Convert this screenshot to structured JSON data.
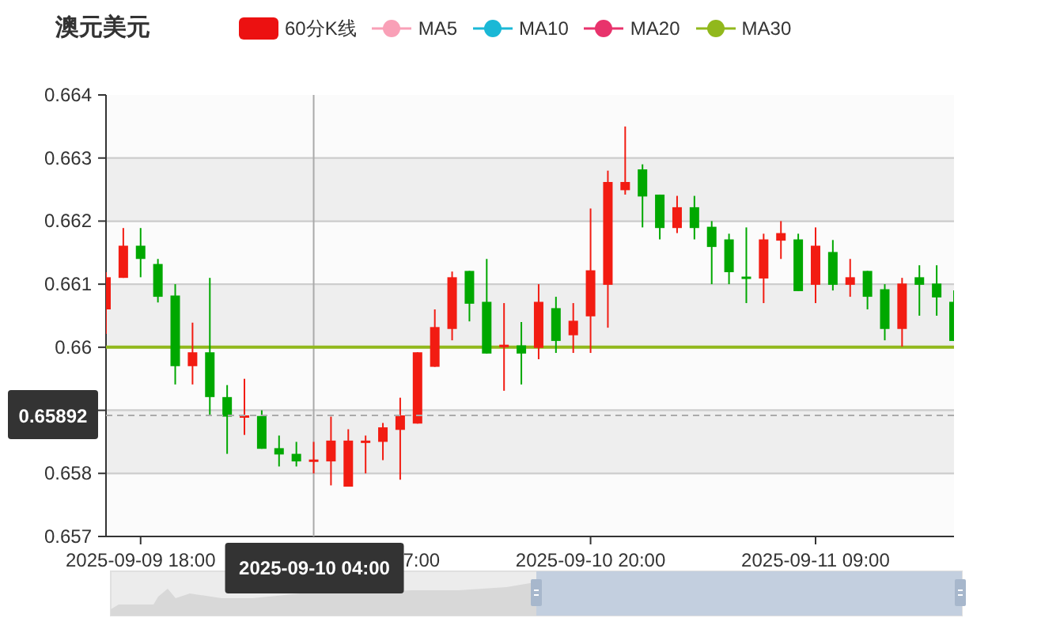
{
  "title": "澳元美元",
  "legend": [
    {
      "label": "60分K线",
      "kind": "candle",
      "color": "#ec1111"
    }
  ],
  "chart": {
    "chart_data": {
      "type": "candlestick",
      "categories": [
        null,
        null,
        "2025-09-09 18:00",
        null,
        null,
        null,
        null,
        null,
        null,
        null,
        null,
        null,
        "2025-09-10 04:00",
        null,
        null,
        null,
        null,
        null,
        null,
        null,
        null,
        null,
        null,
        null,
        null,
        null,
        null,
        null,
        "2025-09-10 20:00",
        null,
        null,
        null,
        null,
        null,
        null,
        null,
        null,
        null,
        null,
        null,
        null,
        "2025-09-11 09:00",
        null,
        null,
        null,
        null,
        null,
        null,
        null,
        null
      ],
      "ohlc": [
        [
          0.6606,
          0.66119,
          0.66021,
          0.66111
        ],
        [
          0.6611,
          0.66189,
          0.6611,
          0.66161
        ],
        [
          0.66161,
          0.66189,
          0.66111,
          0.6614
        ],
        [
          0.66132,
          0.6614,
          0.66071,
          0.6608
        ],
        [
          0.66082,
          0.661,
          0.65941,
          0.6597
        ],
        [
          0.6597,
          0.66039,
          0.65941,
          0.65992
        ],
        [
          0.65992,
          0.6611,
          0.65892,
          0.65921
        ],
        [
          0.65921,
          0.6594,
          0.65831,
          0.6589
        ],
        [
          0.65889,
          0.6595,
          0.65861,
          0.65892
        ],
        [
          0.65891,
          0.659,
          0.65839,
          0.65839
        ],
        [
          0.6584,
          0.6586,
          0.65811,
          0.6583
        ],
        [
          0.65831,
          0.6585,
          0.65811,
          0.65819
        ],
        [
          0.65819,
          0.6585,
          0.658,
          0.65822
        ],
        [
          0.65819,
          0.6589,
          0.65781,
          0.65852
        ],
        [
          0.65779,
          0.6587,
          0.65779,
          0.65852
        ],
        [
          0.6585,
          0.6586,
          0.658,
          0.65852
        ],
        [
          0.6585,
          0.6588,
          0.65821,
          0.65873
        ],
        [
          0.65869,
          0.6592,
          0.6579,
          0.65892
        ],
        [
          0.65879,
          0.65992,
          0.65879,
          0.65992
        ],
        [
          0.65969,
          0.6606,
          0.65969,
          0.66032
        ],
        [
          0.66029,
          0.6612,
          0.66011,
          0.66111
        ],
        [
          0.66121,
          0.66121,
          0.66041,
          0.66069
        ],
        [
          0.66072,
          0.6614,
          0.6599,
          0.6599
        ],
        [
          0.66,
          0.6607,
          0.65931,
          0.66004
        ],
        [
          0.66003,
          0.6604,
          0.65941,
          0.6599
        ],
        [
          0.65999,
          0.661,
          0.65981,
          0.66072
        ],
        [
          0.66062,
          0.6608,
          0.65991,
          0.6601
        ],
        [
          0.66019,
          0.6607,
          0.65991,
          0.66042
        ],
        [
          0.66049,
          0.6622,
          0.65991,
          0.66122
        ],
        [
          0.66099,
          0.6628,
          0.66031,
          0.66262
        ],
        [
          0.66249,
          0.6635,
          0.66242,
          0.66262
        ],
        [
          0.66282,
          0.6629,
          0.6619,
          0.66239
        ],
        [
          0.66242,
          0.66242,
          0.66171,
          0.66189
        ],
        [
          0.66189,
          0.6624,
          0.66181,
          0.66222
        ],
        [
          0.66222,
          0.6624,
          0.66171,
          0.66189
        ],
        [
          0.66191,
          0.662,
          0.661,
          0.66159
        ],
        [
          0.66171,
          0.6618,
          0.661,
          0.66119
        ],
        [
          0.66112,
          0.6619,
          0.6607,
          0.6611
        ],
        [
          0.66109,
          0.6618,
          0.6607,
          0.66171
        ],
        [
          0.66169,
          0.662,
          0.6614,
          0.66181
        ],
        [
          0.66171,
          0.6618,
          0.66089,
          0.66089
        ],
        [
          0.66099,
          0.6619,
          0.6607,
          0.66161
        ],
        [
          0.66151,
          0.6617,
          0.6609,
          0.66099
        ],
        [
          0.66099,
          0.6614,
          0.6608,
          0.66111
        ],
        [
          0.66121,
          0.66121,
          0.6606,
          0.6608
        ],
        [
          0.66092,
          0.661,
          0.66011,
          0.66029
        ],
        [
          0.66029,
          0.6611,
          0.66001,
          0.66101
        ],
        [
          0.66111,
          0.6613,
          0.6605,
          0.66099
        ],
        [
          0.66101,
          0.6613,
          0.6605,
          0.66079
        ],
        [
          0.66072,
          0.6609,
          0.6601,
          0.6601
        ]
      ],
      "series": [
        {
          "name": "MA5",
          "type": "line",
          "color": "#f9a0b7",
          "values": [
            null,
            null,
            null,
            null,
            null,
            null,
            null,
            null,
            null,
            null,
            null,
            null,
            null,
            null,
            null,
            null,
            null,
            null,
            null,
            null,
            null,
            null,
            null,
            null,
            null,
            null,
            null,
            null,
            null,
            null,
            null,
            null,
            null,
            null,
            null,
            null,
            null,
            null,
            null,
            null,
            null,
            null,
            null,
            null,
            null,
            null,
            null,
            null,
            null,
            null
          ]
        },
        {
          "name": "MA10",
          "type": "line",
          "color": "#1ab8d6",
          "values": [
            null,
            null,
            null,
            null,
            null,
            null,
            null,
            null,
            null,
            null,
            null,
            null,
            null,
            null,
            null,
            null,
            null,
            null,
            null,
            null,
            null,
            null,
            null,
            null,
            null,
            null,
            null,
            null,
            null,
            null,
            null,
            null,
            null,
            null,
            null,
            null,
            null,
            null,
            null,
            null,
            null,
            null,
            null,
            null,
            null,
            null,
            null,
            null,
            null,
            null
          ]
        },
        {
          "name": "MA20",
          "type": "line",
          "color": "#e8336c",
          "values": [
            null,
            null,
            null,
            null,
            null,
            null,
            null,
            null,
            null,
            null,
            null,
            null,
            null,
            null,
            null,
            null,
            null,
            null,
            null,
            null,
            null,
            null,
            null,
            null,
            null,
            null,
            null,
            null,
            null,
            null,
            null,
            null,
            null,
            null,
            null,
            null,
            null,
            null,
            null,
            null,
            null,
            null,
            null,
            null,
            null,
            null,
            null,
            null,
            null,
            null
          ]
        },
        {
          "name": "MA30",
          "type": "line",
          "color": "#91b81c",
          "values": [
            0.66,
            0.66,
            0.66,
            0.66,
            0.66,
            0.66,
            0.66,
            0.66,
            0.66,
            0.66,
            0.66,
            0.66,
            0.66,
            0.66,
            0.66,
            0.66,
            0.66,
            0.66,
            0.66,
            0.66,
            0.66,
            0.66,
            0.66,
            0.66,
            0.66,
            0.66,
            0.66,
            0.66,
            0.66,
            0.66,
            0.66,
            0.66,
            0.66,
            0.66,
            0.66,
            0.66,
            0.66,
            0.66,
            0.66,
            0.66,
            0.66,
            0.66,
            0.66,
            0.66,
            0.66,
            0.66,
            0.66,
            0.66,
            0.66,
            0.66
          ]
        }
      ],
      "grid": true,
      "ylim": [
        0.657,
        0.664
      ],
      "yticks": [
        0.657,
        0.658,
        0.66,
        0.661,
        0.662,
        0.663,
        0.664
      ],
      "bands": [
        {
          "axis": "y",
          "from": 0.662,
          "to": 0.663
        },
        {
          "axis": "y",
          "from": 0.66,
          "to": 0.661
        },
        {
          "axis": "y",
          "from": 0.658,
          "to": 0.659
        }
      ],
      "ref_lines": [
        {
          "axis": "y",
          "value": 0.65892,
          "label": "0.65892"
        }
      ]
    },
    "covered_axis_label": "7:00"
  },
  "range_slider": {
    "level": 0.5
  }
}
